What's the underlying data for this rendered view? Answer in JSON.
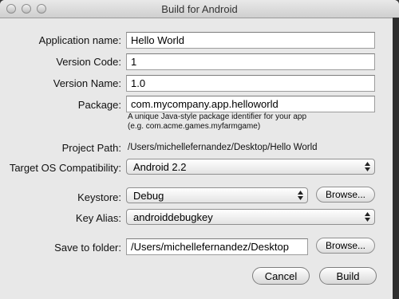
{
  "window": {
    "title": "Build for Android"
  },
  "form": {
    "app_name": {
      "label": "Application name:",
      "value": "Hello World"
    },
    "version_code": {
      "label": "Version Code:",
      "value": "1"
    },
    "version_name": {
      "label": "Version Name:",
      "value": "1.0"
    },
    "package": {
      "label": "Package:",
      "value": "com.mycompany.app.helloworld",
      "hint_line1": "A unique Java-style package identifier for your app",
      "hint_line2": "(e.g. com.acme.games.myfarmgame)"
    },
    "project_path": {
      "label": "Project Path:",
      "value": "/Users/michellefernandez/Desktop/Hello World"
    },
    "target_os": {
      "label": "Target OS Compatibility:",
      "value": "Android 2.2"
    },
    "keystore": {
      "label": "Keystore:",
      "value": "Debug",
      "browse_label": "Browse..."
    },
    "key_alias": {
      "label": "Key Alias:",
      "value": "androiddebugkey"
    },
    "save_folder": {
      "label": "Save to folder:",
      "value": "/Users/michellefernandez/Desktop",
      "browse_label": "Browse..."
    }
  },
  "actions": {
    "cancel_label": "Cancel",
    "build_label": "Build"
  }
}
